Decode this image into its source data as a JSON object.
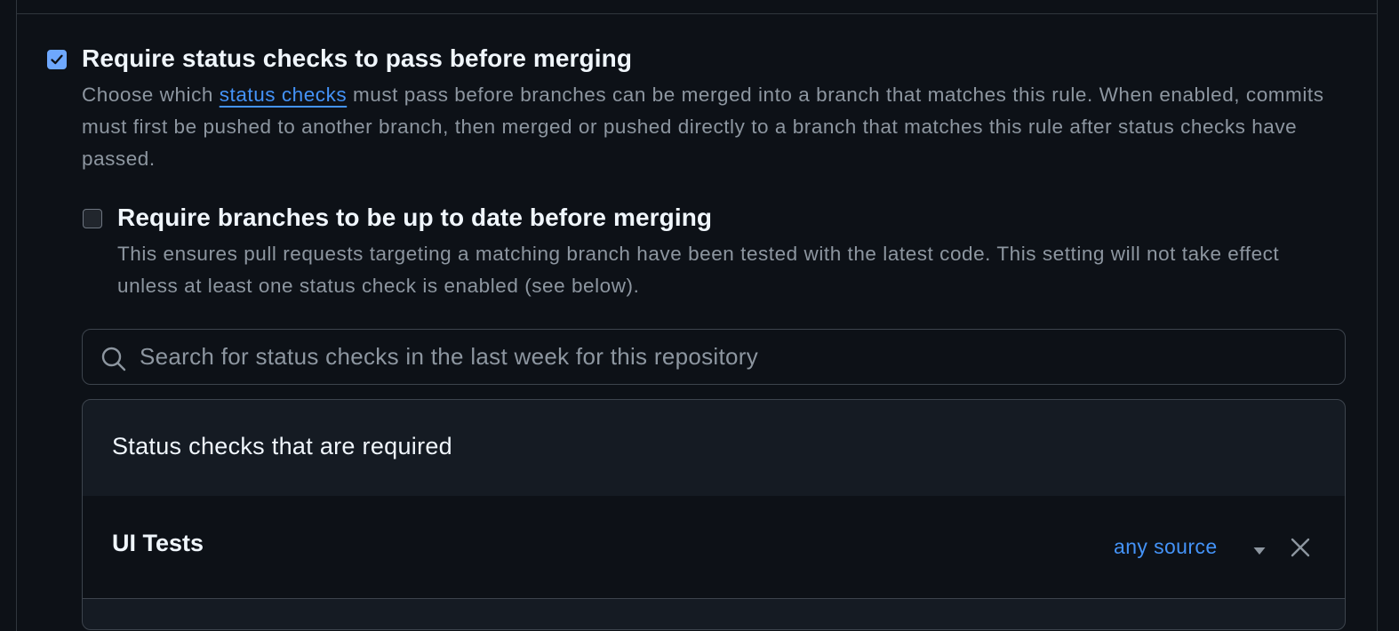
{
  "require_status_checks": {
    "checked": true,
    "title": "Require status checks to pass before merging",
    "desc_prefix": "Choose which ",
    "desc_link": "status checks",
    "desc_suffix": " must pass before branches can be merged into a branch that matches this rule. When enabled, commits must first be pushed to another branch, then merged or pushed directly to a branch that matches this rule after status checks have passed."
  },
  "require_up_to_date": {
    "checked": false,
    "title": "Require branches to be up to date before merging",
    "desc": "This ensures pull requests targeting a matching branch have been tested with the latest code. This setting will not take effect unless at least one status check is enabled (see below)."
  },
  "search": {
    "placeholder": "Search for status checks in the last week for this repository",
    "value": ""
  },
  "required_checks": {
    "header": "Status checks that are required",
    "items": [
      {
        "name": "UI Tests",
        "source": "any source"
      }
    ]
  },
  "colors": {
    "background": "#0d1117",
    "panel_header": "#151b23",
    "border": "#3d444d",
    "accent": "#4493f8",
    "checkbox_checked": "#6ea8fe",
    "muted_text": "#8d96a0"
  },
  "icons": {
    "checked_box": "checkmark-icon",
    "search": "search-icon",
    "dropdown": "triangle-down-icon",
    "remove": "x-icon"
  }
}
